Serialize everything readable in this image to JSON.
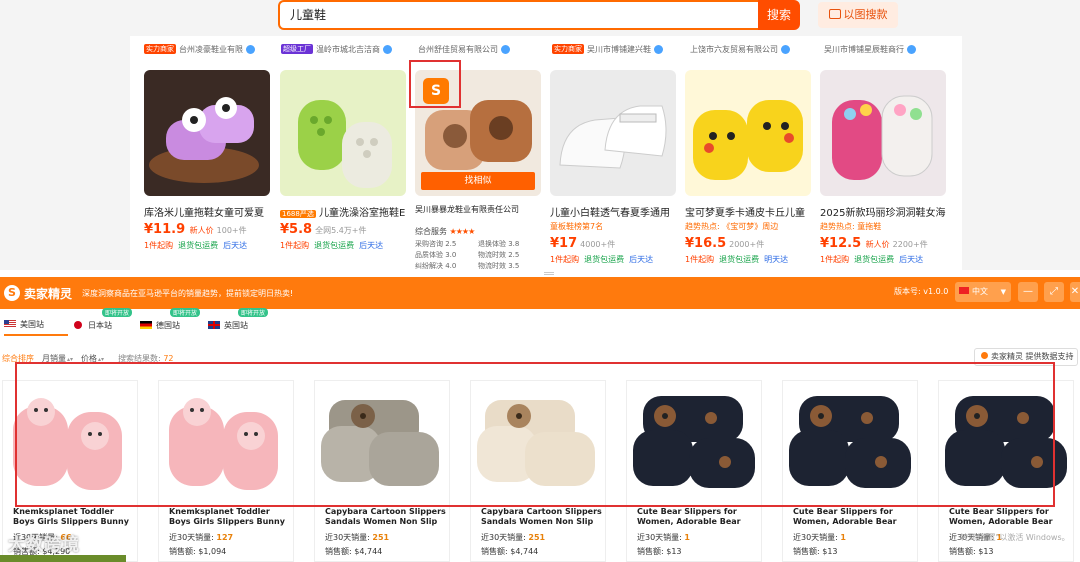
{
  "search": {
    "query": "儿童鞋",
    "button": "搜索",
    "image_search": "以图搜款"
  },
  "prev_row": [
    {
      "badge": "实力商家",
      "badge_kind": "red",
      "seller": "台州凌豪鞋业有限"
    },
    {
      "badge": "超级工厂",
      "badge_kind": "purple",
      "seller": "温岭市城北吉洁商"
    },
    {
      "badge": "",
      "badge_kind": "",
      "seller": "台州舒佳贸易有限公司"
    },
    {
      "badge": "实力商家",
      "badge_kind": "red",
      "seller": "吴川市博铺建兴鞋"
    },
    {
      "badge": "",
      "badge_kind": "",
      "seller": "上饶市六友贸易有限公司"
    },
    {
      "badge": "",
      "badge_kind": "",
      "seller": "吴川市博铺星辰鞋商行"
    }
  ],
  "cards": [
    {
      "title": "库洛米儿童拖鞋女童可爱夏",
      "sub": "",
      "price": "¥11.9",
      "price_note": "新人价",
      "sold": "100+件",
      "tags": [
        "1件起购",
        "退货包运费",
        "后天达"
      ]
    },
    {
      "title": "儿童洗澡浴室拖鞋E",
      "tag_prefix": "1688严选",
      "sub": "",
      "price": "¥5.8",
      "price_note": "",
      "sold": "全网5.4万+件",
      "tags": [
        "1件起购",
        "退货包运费",
        "后天达"
      ]
    },
    {
      "title": "吴川暴暴龙鞋业有限责任公司",
      "find_similar": "找相似",
      "rating_label": "综合服务",
      "stars": "★★★★",
      "rating_rows": [
        "采购咨询 2.5",
        "退换体验 3.8",
        "品质体验 3.0",
        "物流时效 2.5",
        "纠纷解决 4.0",
        "物流时效 3.5"
      ]
    },
    {
      "title": "儿童小白鞋透气春夏季通用",
      "sub": "童板鞋榜第7名",
      "price": "¥17",
      "price_note": "",
      "sold": "4000+件",
      "tags": [
        "1件起购",
        "退货包运费",
        "后天达"
      ]
    },
    {
      "title": "宝可梦夏季卡通皮卡丘儿童",
      "sub": "趋势热点: 《宝可梦》周边",
      "price": "¥16.5",
      "price_note": "",
      "sold": "2000+件",
      "tags": [
        "1件起购",
        "退货包运费",
        "明天达"
      ]
    },
    {
      "title": "2025新款玛丽珍洞洞鞋女海",
      "sub": "趋势热点: 童拖鞋",
      "price": "¥12.5",
      "price_note": "新人价",
      "sold": "2200+件",
      "tags": [
        "1件起购",
        "退货包运费",
        "后天达"
      ]
    }
  ],
  "plugin": {
    "brand": "卖家精灵",
    "notice": "深度洞察商品在亚马逊平台的销量趋势，提前锁定明日热卖!",
    "version": "版本号: v1.0.0",
    "language": "中文",
    "sites": [
      {
        "label": "美国站",
        "soon": ""
      },
      {
        "label": "日本站",
        "soon": "即将开放"
      },
      {
        "label": "德国站",
        "soon": "即将开放"
      },
      {
        "label": "英国站",
        "soon": "即将开放"
      }
    ],
    "sort": {
      "all": "综合排序",
      "monthly": "月销量",
      "price": "价格",
      "count_label": "搜索结果数:",
      "count": "72"
    },
    "support": "卖家精灵 提供数据支持"
  },
  "products": [
    {
      "title": "Knemksplanet Toddler Boys Girls Slippers Bunny Unicorn...",
      "sales_label": "近30天销量:",
      "sales": "66",
      "price_label": "销售额:",
      "price": "$4,290"
    },
    {
      "title": "Knemksplanet Toddler Boys Girls Slippers Bunny Unicorn...",
      "sales_label": "近30天销量:",
      "sales": "127",
      "price_label": "销售额:",
      "price": "$1,094"
    },
    {
      "title": "Capybara Cartoon Slippers Sandals Women Non Slip -...",
      "sales_label": "近30天销量:",
      "sales": "251",
      "price_label": "销售额:",
      "price": "$4,744"
    },
    {
      "title": "Capybara Cartoon Slippers Sandals Women Non Slip -...",
      "sales_label": "近30天销量:",
      "sales": "251",
      "price_label": "销售额:",
      "price": "$4,744"
    },
    {
      "title": "Cute Bear Slippers for Women, Adorable Bear Print, Chunky...",
      "sales_label": "近30天销量:",
      "sales": "1",
      "price_label": "销售额:",
      "price": "$13"
    },
    {
      "title": "Cute Bear Slippers for Women, Adorable Bear Print, Chunky...",
      "sales_label": "近30天销量:",
      "sales": "1",
      "price_label": "销售额:",
      "price": "$13"
    },
    {
      "title": "Cute Bear Slippers for Women, Adorable Bear Print, Chunky...",
      "sales_label": "近30天销量:",
      "sales": "1",
      "price_label": "销售额:",
      "price": "$13"
    }
  ],
  "watermark": {
    "brand": "大数跨境",
    "windows": "转到\"设置\"以激活 Windows。"
  }
}
